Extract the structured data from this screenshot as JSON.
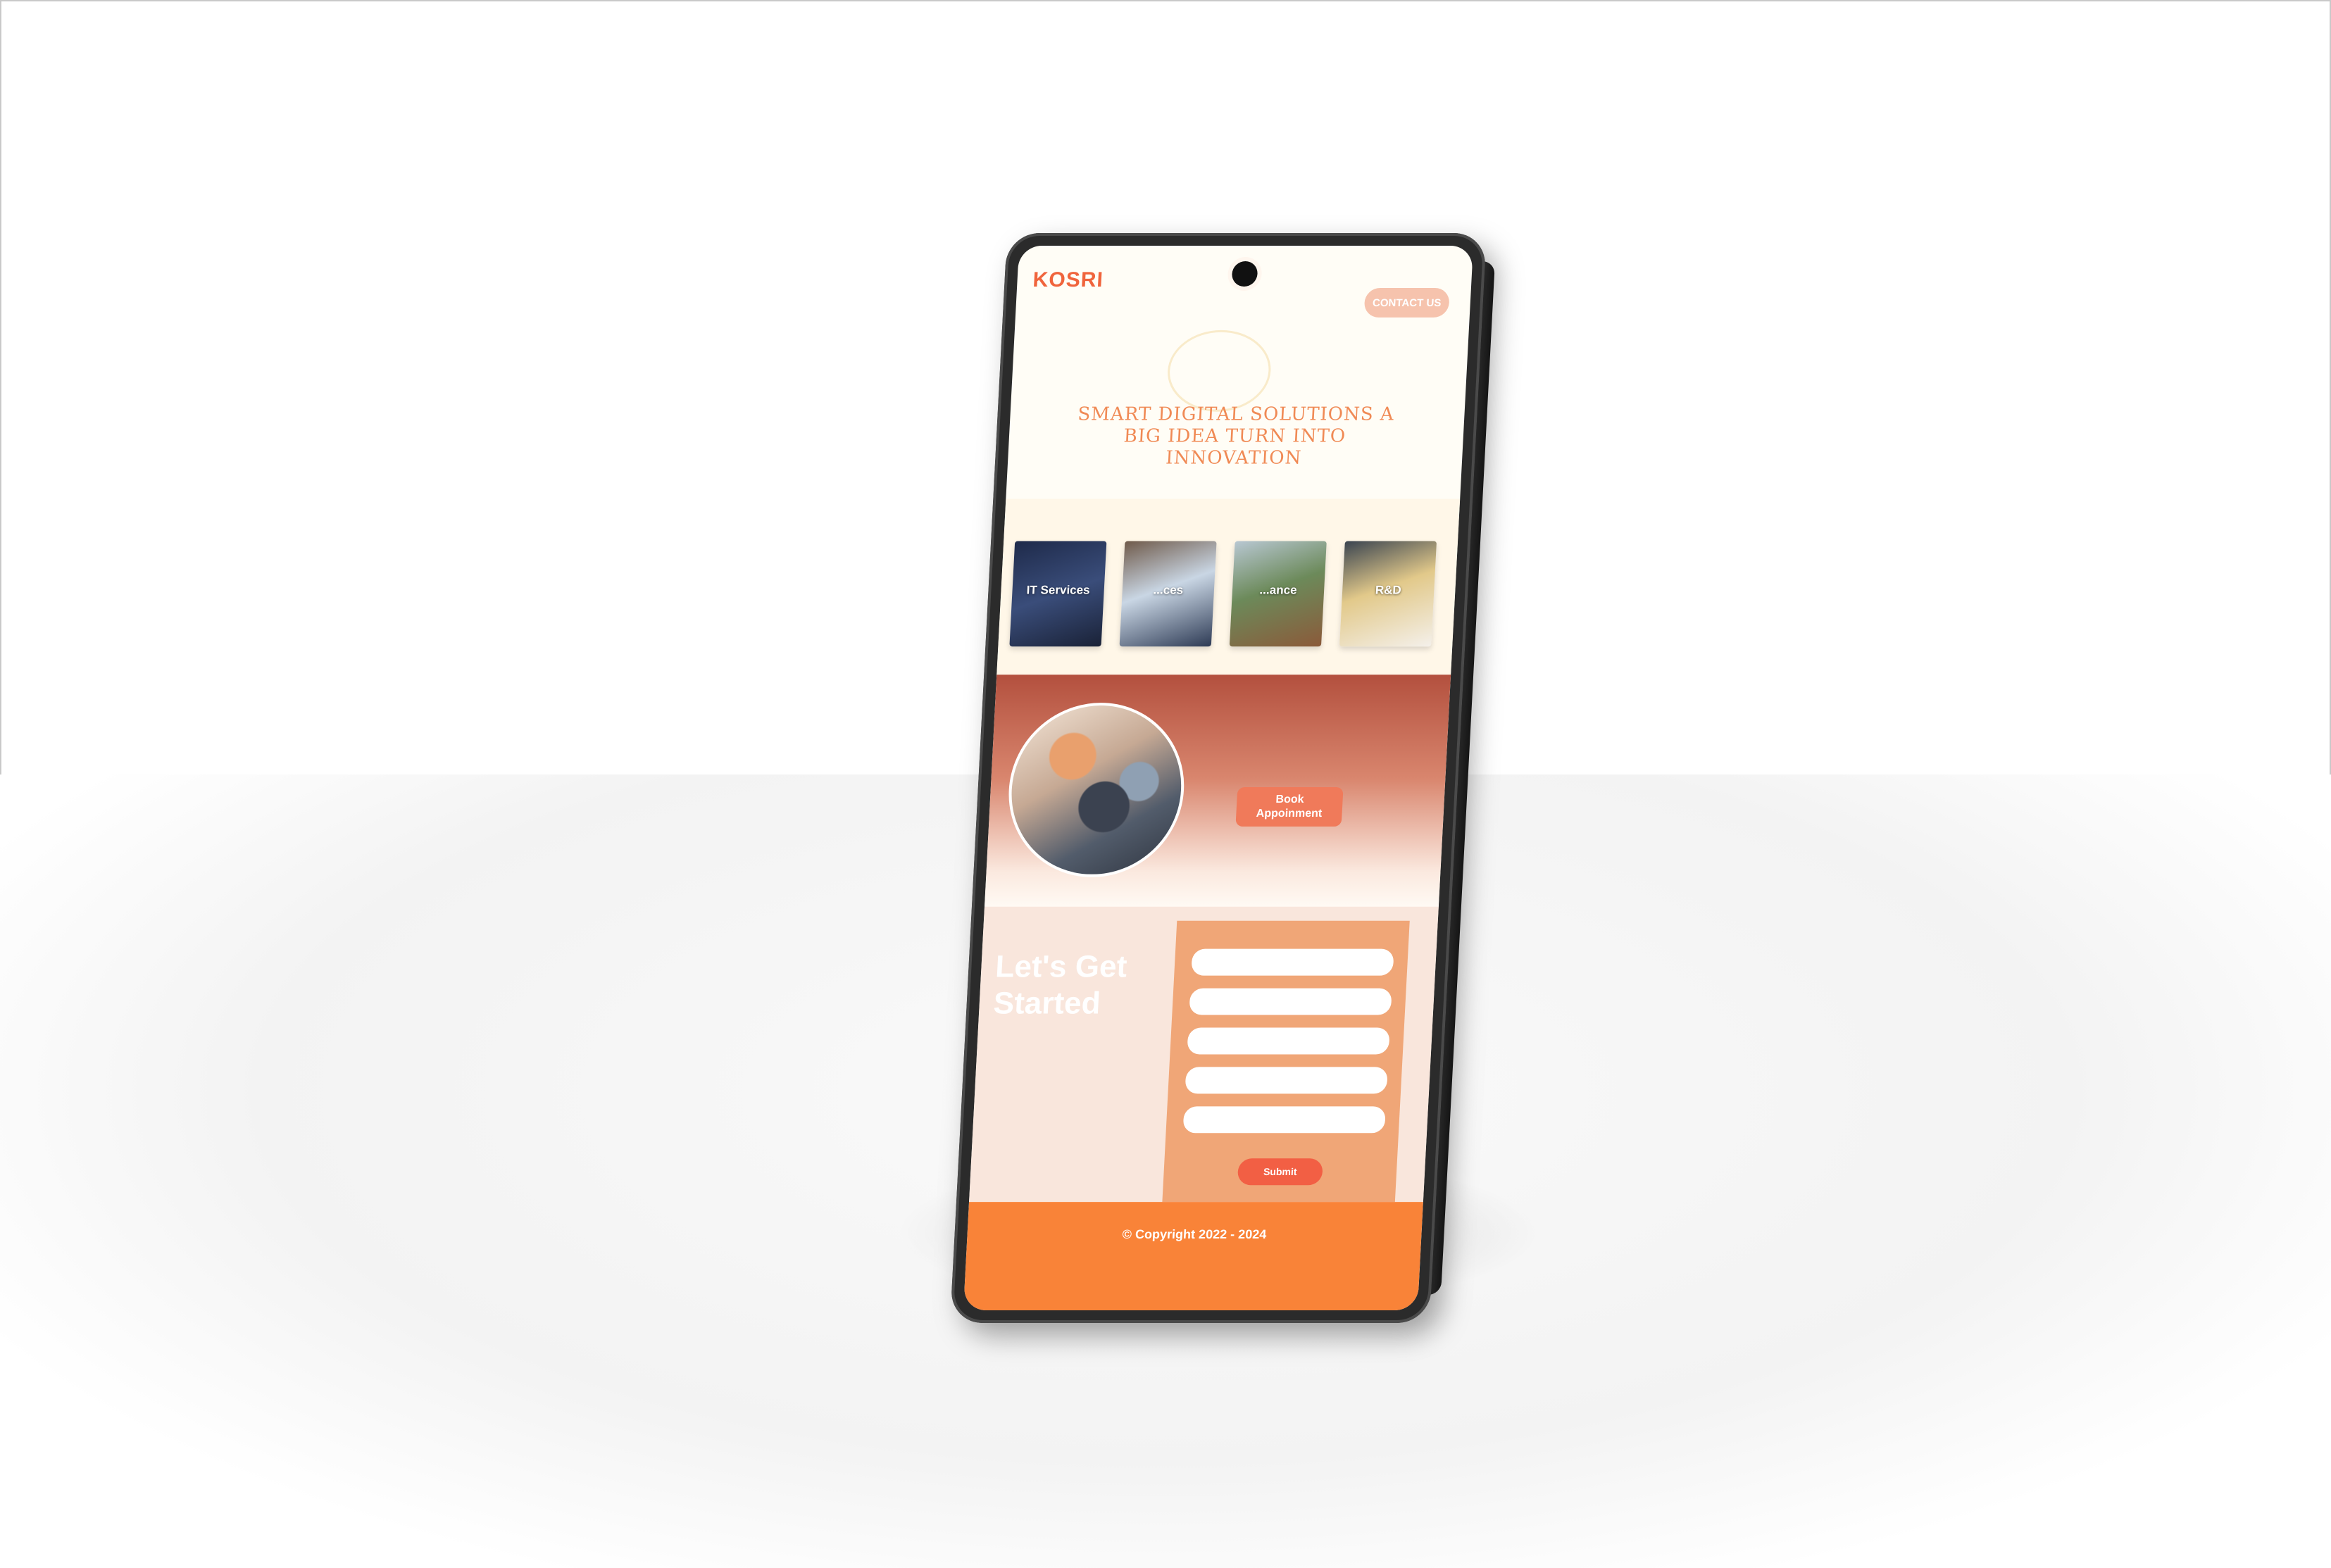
{
  "site": {
    "logo": "KOSRI",
    "contact_label": "CONTACT US"
  },
  "hero": {
    "title": "SMART DIGITAL SOLUTIONS A BIG IDEA TURN INTO INNOVATION"
  },
  "services": [
    {
      "label": "IT Services"
    },
    {
      "label": "...ces"
    },
    {
      "label": "...ance"
    },
    {
      "label": "R&D"
    }
  ],
  "promo": {
    "book_label": "Book Appoinment"
  },
  "get_started": {
    "title": "Let's Get Started",
    "submit_label": "Submit"
  },
  "footer": {
    "copyright": "© Copyright 2022 - 2024"
  },
  "colors": {
    "accent": "#f98338",
    "brand": "#f0643c",
    "button": "#f25f44"
  }
}
